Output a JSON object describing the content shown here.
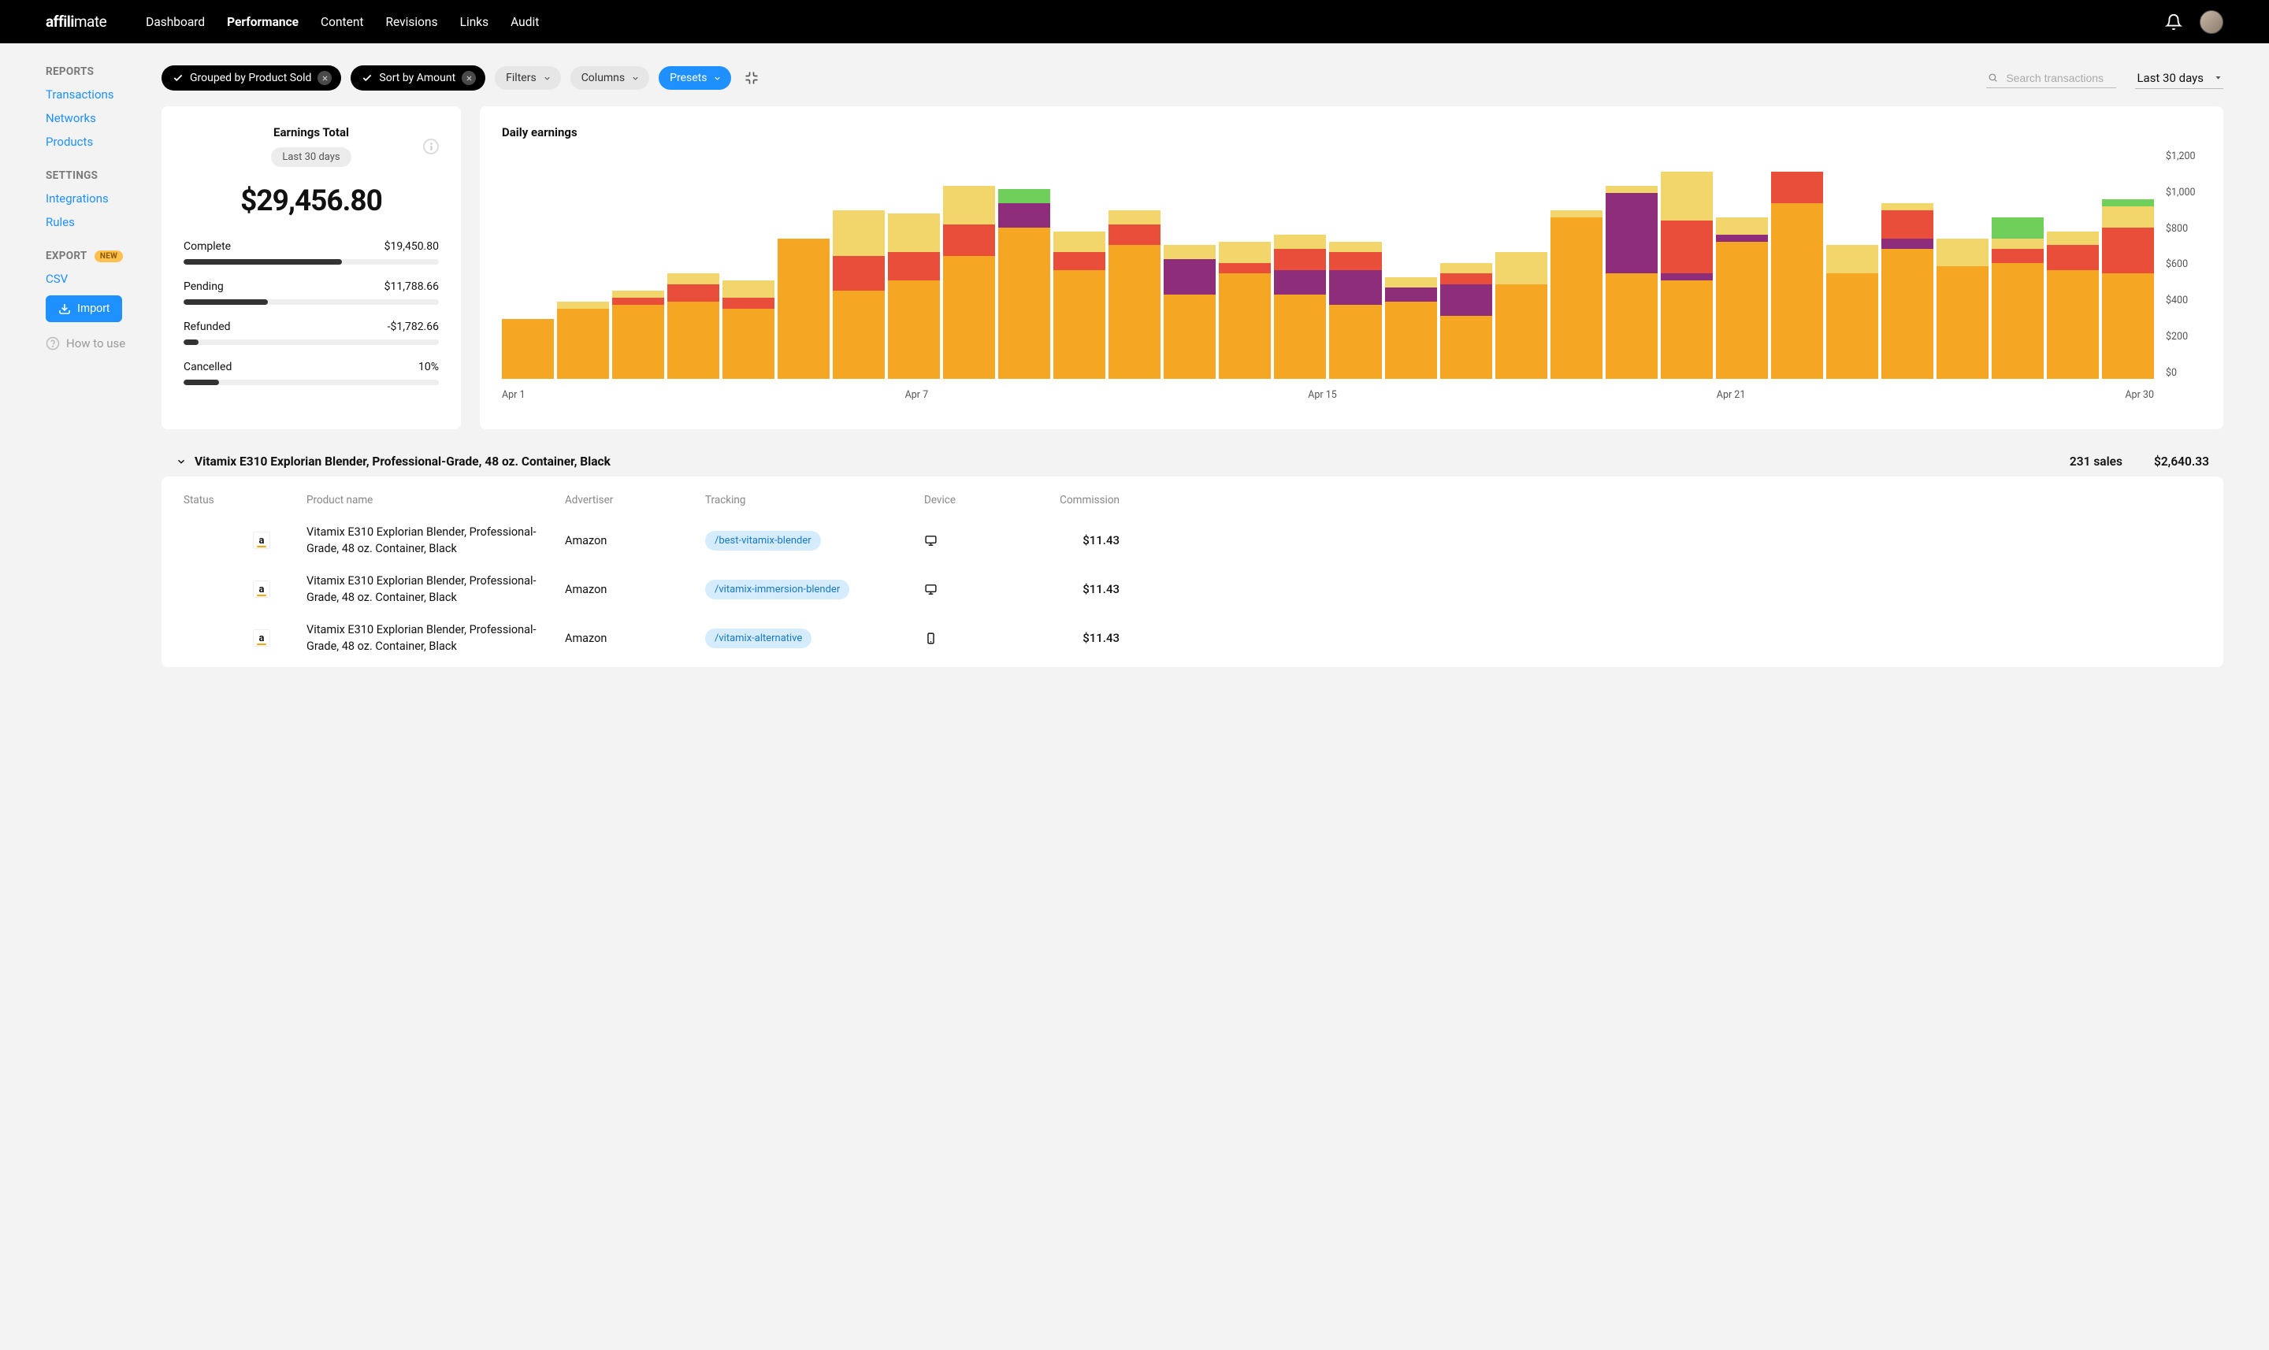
{
  "brand": {
    "a": "affili",
    "b": "mate"
  },
  "topnav": {
    "items": [
      "Dashboard",
      "Performance",
      "Content",
      "Revisions",
      "Links",
      "Audit"
    ],
    "active": 1
  },
  "sidebar": {
    "reports": {
      "heading": "REPORTS",
      "items": [
        "Transactions",
        "Networks",
        "Products"
      ]
    },
    "settings": {
      "heading": "SETTINGS",
      "items": [
        "Integrations",
        "Rules"
      ]
    },
    "export": {
      "heading": "EXPORT",
      "new_badge": "NEW",
      "items": [
        "CSV"
      ]
    },
    "import_btn": "Import",
    "how_to_use": "How to use"
  },
  "filters": {
    "chips": {
      "grouped": "Grouped by Product Sold",
      "sort": "Sort by Amount",
      "filters": "Filters",
      "columns": "Columns",
      "presets": "Presets"
    },
    "search_placeholder": "Search transactions",
    "date_range": "Last 30 days"
  },
  "earnings": {
    "title": "Earnings Total",
    "range": "Last 30 days",
    "total": "$29,456.80",
    "breakdown": [
      {
        "label": "Complete",
        "value": "$19,450.80",
        "pct": 62
      },
      {
        "label": "Pending",
        "value": "$11,788.66",
        "pct": 33
      },
      {
        "label": "Refunded",
        "value": "-$1,782.66",
        "pct": 6
      },
      {
        "label": "Cancelled",
        "value": "10%",
        "pct": 14
      }
    ]
  },
  "chart": {
    "title": "Daily earnings",
    "y_ticks": [
      "$1,200",
      "$1,000",
      "$800",
      "$600",
      "$400",
      "$200",
      "$0"
    ],
    "x_ticks": [
      "Apr 1",
      "Apr 7",
      "Apr 15",
      "Apr 21",
      "Apr 30"
    ]
  },
  "chart_data": {
    "type": "bar",
    "title": "Daily earnings",
    "xlabel": "",
    "ylabel": "",
    "ylim": [
      0,
      1300
    ],
    "categories": [
      "Apr 1",
      "Apr 2",
      "Apr 3",
      "Apr 4",
      "Apr 5",
      "Apr 6",
      "Apr 7",
      "Apr 8",
      "Apr 9",
      "Apr 10",
      "Apr 11",
      "Apr 12",
      "Apr 13",
      "Apr 14",
      "Apr 15",
      "Apr 16",
      "Apr 17",
      "Apr 18",
      "Apr 19",
      "Apr 20",
      "Apr 21",
      "Apr 22",
      "Apr 23",
      "Apr 24",
      "Apr 25",
      "Apr 26",
      "Apr 27",
      "Apr 28",
      "Apr 29",
      "Apr 30"
    ],
    "stack_colors": {
      "orange": "#f5a623",
      "yellow": "#f3d66b",
      "red": "#e94e3b",
      "purple": "#8e2e7a",
      "green": "#6fcf5a"
    },
    "series": [
      {
        "name": "orange",
        "values": [
          340,
          400,
          420,
          440,
          400,
          800,
          500,
          560,
          700,
          860,
          620,
          760,
          480,
          600,
          480,
          420,
          440,
          360,
          540,
          920,
          600,
          560,
          780,
          1000,
          600,
          740,
          640,
          660,
          620,
          600
        ]
      },
      {
        "name": "purple",
        "values": [
          0,
          0,
          0,
          0,
          0,
          0,
          0,
          0,
          0,
          140,
          0,
          0,
          200,
          0,
          140,
          200,
          80,
          180,
          0,
          0,
          460,
          40,
          40,
          0,
          0,
          60,
          0,
          0,
          0,
          0
        ]
      },
      {
        "name": "red",
        "values": [
          0,
          0,
          40,
          100,
          60,
          0,
          200,
          160,
          180,
          0,
          100,
          120,
          0,
          60,
          120,
          100,
          0,
          60,
          0,
          0,
          0,
          300,
          0,
          180,
          0,
          160,
          0,
          80,
          140,
          260
        ]
      },
      {
        "name": "yellow",
        "values": [
          0,
          40,
          40,
          60,
          100,
          0,
          260,
          220,
          220,
          0,
          120,
          80,
          80,
          120,
          80,
          60,
          60,
          60,
          180,
          40,
          40,
          280,
          100,
          0,
          160,
          40,
          160,
          60,
          80,
          120
        ]
      },
      {
        "name": "green",
        "values": [
          0,
          0,
          0,
          0,
          0,
          0,
          0,
          0,
          0,
          80,
          0,
          0,
          0,
          0,
          0,
          0,
          0,
          0,
          0,
          0,
          0,
          0,
          0,
          0,
          0,
          0,
          0,
          120,
          0,
          40
        ]
      }
    ]
  },
  "group": {
    "title": "Vitamix E310 Explorian Blender, Professional-Grade, 48 oz. Container, Black",
    "sales": "231 sales",
    "total": "$2,640.33"
  },
  "table": {
    "headers": {
      "status": "Status",
      "product": "Product name",
      "advertiser": "Advertiser",
      "tracking": "Tracking",
      "device": "Device",
      "commission": "Commission"
    },
    "rows": [
      {
        "product": "Vitamix E310 Explorian Blender, Professional-Grade, 48 oz. Container, Black",
        "advertiser": "Amazon",
        "tracking": "/best-vitamix-blender",
        "device": "desktop",
        "commission": "$11.43"
      },
      {
        "product": "Vitamix E310 Explorian Blender, Professional-Grade, 48 oz. Container, Black",
        "advertiser": "Amazon",
        "tracking": "/vitamix-immersion-blender",
        "device": "desktop",
        "commission": "$11.43"
      },
      {
        "product": "Vitamix E310 Explorian Blender, Professional-Grade, 48 oz. Container, Black",
        "advertiser": "Amazon",
        "tracking": "/vitamix-alternative",
        "device": "mobile",
        "commission": "$11.43"
      }
    ]
  }
}
